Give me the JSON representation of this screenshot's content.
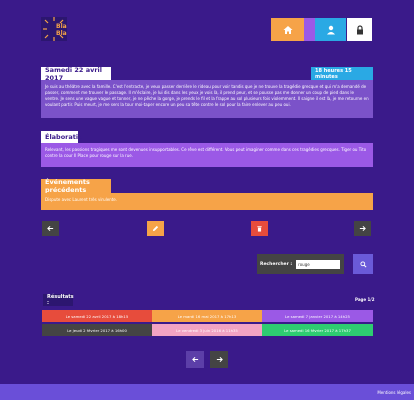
{
  "brand": {
    "logo_text_top": "Bla",
    "logo_text_bottom": "Bla"
  },
  "nav": {
    "home_icon": "home-icon",
    "book_icon": "book-icon",
    "user_icon": "user-icon",
    "lock_icon": "lock-icon"
  },
  "entry": {
    "date": "Samedi 22 avril 2017",
    "time": "18 heures 15 minutes",
    "text": "Je suis au théâtre avec la famille. C'est l'entracte, je veux passer derrière le rideau pour voir tandis que je ne trouve la tragédie grecque et qui m'a demandé de passer, comment me trouver le passage. Il m'éclaire, je lui dis dans les yeux je vois là, il prend peur, et se pousse pas me donner un coup de pied dans le ventre. Je sens une vague vague et tonner, je ne pêche la gorge, je prends le fil et la frappe au sol plusieurs fois violemment. Il saigne il est là, je me retourne en voulant partir. Puis meurt, je me sers la tour moi-taper encore un peu sa tête contre le sol pour la faire enlever au peu oui."
  },
  "elaboration": {
    "title": "Élaboration",
    "text": "Relevant, les passions tragiques me sont devenues insupportables. Ce rêve est différent. Vous peut imaginer comme dans ces tragédies grecques. Tiger ou Tito contre la cour Il Place pour rouge sur la rue."
  },
  "previous": {
    "title": "Événements précédents",
    "text": "Dispute avec Laurent très virulente."
  },
  "controls": {
    "prev_icon": "arrow-left-icon",
    "edit_icon": "pencil-icon",
    "delete_icon": "trash-icon",
    "next_icon": "arrow-right-icon"
  },
  "search": {
    "label": "Rechercher :",
    "value": "rouge",
    "button_icon": "search-icon"
  },
  "results": {
    "title": "Résultats :",
    "page": "Page 1/2",
    "rows": [
      [
        "Le samedi 22 avril 2017 à 18h15",
        "Le mardi 16 mai 2017 à 17h13",
        "Le samedi 7 janvier 2017 à 14h25"
      ],
      [
        "Le jeudi 2 février 2017 à 16h00",
        "Le vendredi 3 juin 2016 à 11h35",
        "Le samedi 16 février 2017 à 17h37"
      ]
    ]
  },
  "pager": {
    "prev_icon": "arrow-left-icon",
    "next_icon": "arrow-right-icon"
  },
  "footer": {
    "legal": "Mentions légales"
  },
  "colors": {
    "background": "#3a1a8a",
    "orange": "#f6a348",
    "purple": "#9b59e6",
    "blue": "#2aa9e4",
    "red": "#e74c3c",
    "green": "#2ecc71",
    "pink": "#f2a3c3",
    "violet_panel": "#7b52c9"
  }
}
